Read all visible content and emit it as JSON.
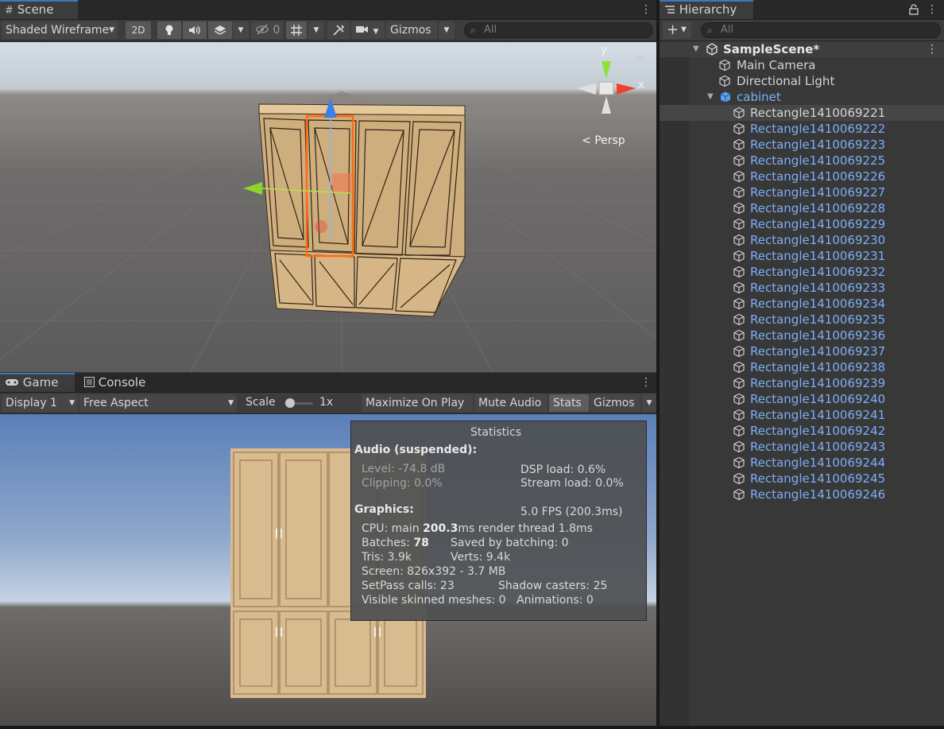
{
  "scene": {
    "tab_label": "Scene",
    "shading_mode": "Shaded Wireframe",
    "btn_2d": "2D",
    "hidden_count": "0",
    "gizmos_label": "Gizmos",
    "search_placeholder": "All",
    "persp_label": "Persp",
    "axis_y": "y",
    "axis_x": "x"
  },
  "game": {
    "tabs": [
      "Game",
      "Console"
    ],
    "display": "Display 1",
    "aspect": "Free Aspect",
    "scale_label": "Scale",
    "scale_value": 0.05,
    "scale_text": "1x",
    "maximize": "Maximize On Play",
    "mute": "Mute Audio",
    "stats": "Stats",
    "gizmos": "Gizmos"
  },
  "statistics": {
    "title": "Statistics",
    "audio_header": "Audio (suspended):",
    "level": "Level: -74.8 dB",
    "clipping": "Clipping: 0.0%",
    "dsp": "DSP load: 0.6%",
    "stream": "Stream load: 0.0%",
    "graphics_header": "Graphics:",
    "fps": "5.0 FPS (200.3ms)",
    "cpu_prefix": "CPU: main ",
    "cpu_main": "200.3",
    "cpu_suffix": "ms  render thread 1.8ms",
    "batches_prefix": "Batches: ",
    "batches": "78",
    "saved": "Saved by batching: 0",
    "tris": "Tris: 3.9k",
    "verts": "Verts: 9.4k",
    "screen": "Screen: 826x392 - 3.7 MB",
    "setpass": "SetPass calls: 23",
    "shadow": "Shadow casters: 25",
    "skinned": "Visible skinned meshes: 0",
    "animations": "Animations: 0"
  },
  "hierarchy": {
    "tab_label": "Hierarchy",
    "search_placeholder": "All",
    "scene_name": "SampleScene*",
    "root_items": [
      "Main Camera",
      "Directional Light"
    ],
    "parent": "cabinet",
    "children": [
      "Rectangle1410069221",
      "Rectangle1410069222",
      "Rectangle1410069223",
      "Rectangle1410069225",
      "Rectangle1410069226",
      "Rectangle1410069227",
      "Rectangle1410069228",
      "Rectangle1410069229",
      "Rectangle1410069230",
      "Rectangle1410069231",
      "Rectangle1410069232",
      "Rectangle1410069233",
      "Rectangle1410069234",
      "Rectangle1410069235",
      "Rectangle1410069236",
      "Rectangle1410069237",
      "Rectangle1410069238",
      "Rectangle1410069239",
      "Rectangle1410069240",
      "Rectangle1410069241",
      "Rectangle1410069242",
      "Rectangle1410069243",
      "Rectangle1410069244",
      "Rectangle1410069245",
      "Rectangle1410069246"
    ],
    "selected_child_index": 0
  },
  "colors": {
    "accent": "#3a79bb",
    "prefab_blue": "#7caef7",
    "panel": "#383838"
  }
}
